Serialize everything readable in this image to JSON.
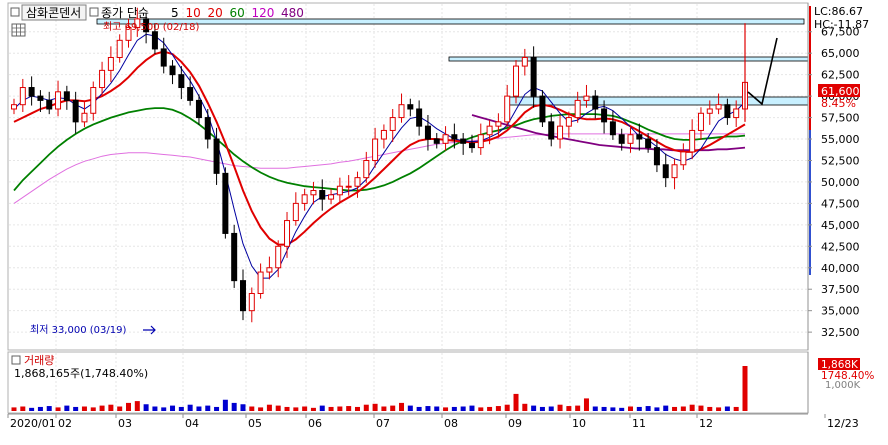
{
  "header": {
    "stock_name": "삼화콘덴서",
    "indicator_label": "종가 단순",
    "ma_periods": [
      "5",
      "10",
      "20",
      "60",
      "120",
      "480"
    ],
    "ma_colors": [
      "#000000",
      "#e00000",
      "#e00000",
      "#008000",
      "#c000c0",
      "#800080"
    ]
  },
  "top_right": {
    "lc": "LC:86.67",
    "hc": "HC:-11.87"
  },
  "annotations": {
    "high": "최고 69,500 (02/18)",
    "low": "최저 33,000 (03/19)"
  },
  "badges": {
    "price": "61,600",
    "pct": "8.45%",
    "volume": "1,868K",
    "volume_pct": "1748.40%"
  },
  "volume_panel": {
    "title": "거래량",
    "summary": "1,868,165주(1,748.40%)",
    "axis_label": "1,000K"
  },
  "chart_data": {
    "type": "candlestick",
    "y_ticks": [
      "67,500",
      "65,000",
      "62,500",
      "60,000",
      "57,500",
      "55,000",
      "52,500",
      "50,000",
      "47,500",
      "45,000",
      "42,500",
      "40,000",
      "37,500",
      "35,000",
      "32,500"
    ],
    "ylim": [
      31000,
      70500
    ],
    "x_labels": [
      "2020/01",
      "02",
      "03",
      "04",
      "05",
      "06",
      "07",
      "08",
      "09",
      "10",
      "11",
      "12",
      "12/23"
    ],
    "closes": [
      59000,
      61000,
      60000,
      59500,
      58500,
      60500,
      59500,
      57000,
      58000,
      61000,
      63000,
      64500,
      66500,
      68000,
      69000,
      67500,
      65500,
      63500,
      62500,
      61000,
      59500,
      57500,
      55000,
      51000,
      44000,
      38500,
      35000,
      37000,
      39500,
      40000,
      42500,
      45500,
      47500,
      48500,
      49000,
      48000,
      48500,
      49500,
      49500,
      50500,
      52500,
      55000,
      56000,
      57500,
      59000,
      58500,
      56500,
      55000,
      54500,
      55500,
      55000,
      54500,
      54000,
      55500,
      56500,
      57000,
      60000,
      63500,
      64500,
      60000,
      57000,
      55000,
      56500,
      57500,
      59500,
      60000,
      58500,
      57000,
      55500,
      54500,
      55500,
      55000,
      54000,
      52000,
      50500,
      52000,
      53500,
      56000,
      58000,
      58500,
      59000,
      57500,
      58500,
      61600
    ],
    "ma_short": [
      58500,
      59500,
      60000,
      59800,
      59500,
      59800,
      59700,
      59000,
      58500,
      59200,
      60300,
      61500,
      63000,
      64800,
      66500,
      67200,
      67000,
      66200,
      64800,
      63200,
      61800,
      60000,
      57900,
      54800,
      51000,
      46800,
      42800,
      40200,
      38800,
      38800,
      39800,
      42000,
      44200,
      46000,
      47600,
      48300,
      48500,
      48700,
      48900,
      49300,
      50300,
      51900,
      53400,
      54900,
      56300,
      57400,
      57600,
      57000,
      56200,
      55600,
      55000,
      54800,
      54700,
      54800,
      55200,
      55700,
      56600,
      58400,
      60200,
      61000,
      60600,
      59300,
      58000,
      57000,
      57200,
      58000,
      58600,
      58800,
      58300,
      57400,
      56400,
      55300,
      54900,
      54100,
      53200,
      52700,
      52400,
      52800,
      53900,
      55500,
      57100,
      57800,
      58300,
      59300
    ],
    "ma_20": [
      57000,
      57500,
      58000,
      58500,
      58800,
      59200,
      59500,
      59500,
      59400,
      59600,
      60000,
      60600,
      61300,
      62200,
      63300,
      64200,
      64900,
      65200,
      64900,
      64000,
      62800,
      61200,
      59200,
      57000,
      54500,
      51800,
      49000,
      46600,
      44700,
      43400,
      42700,
      42700,
      43300,
      44200,
      45200,
      46100,
      46900,
      47600,
      48200,
      48800,
      49600,
      50500,
      51500,
      52500,
      53500,
      54300,
      54800,
      55000,
      55000,
      54900,
      54800,
      54700,
      54600,
      54700,
      54900,
      55300,
      56000,
      57000,
      58100,
      58800,
      59000,
      58800,
      58400,
      57900,
      57500,
      57300,
      57300,
      57400,
      57300,
      57000,
      56500,
      55900,
      55300,
      54700,
      54100,
      53700,
      53500,
      53500,
      53800,
      54300,
      54900,
      55500,
      56100,
      56700
    ],
    "ma_60": [
      49000,
      50200,
      51200,
      52200,
      53200,
      54100,
      54900,
      55600,
      56200,
      56700,
      57100,
      57500,
      57800,
      58100,
      58300,
      58500,
      58600,
      58600,
      58400,
      58000,
      57400,
      56700,
      55900,
      55000,
      54100,
      53200,
      52400,
      51700,
      51100,
      50600,
      50200,
      49900,
      49700,
      49500,
      49400,
      49300,
      49200,
      49100,
      49000,
      49000,
      49100,
      49300,
      49600,
      50000,
      50500,
      51000,
      51600,
      52300,
      53000,
      53700,
      54300,
      54800,
      55200,
      55500,
      55800,
      56000,
      56300,
      56600,
      57000,
      57300,
      57500,
      57700,
      57800,
      57900,
      57900,
      57900,
      57900,
      57800,
      57700,
      57400,
      57000,
      56600,
      56100,
      55700,
      55300,
      55000,
      54900,
      54900,
      55000,
      55100,
      55200,
      55300,
      55300,
      55400
    ],
    "ma_120": [
      47500,
      48200,
      48900,
      49600,
      50300,
      50900,
      51500,
      52000,
      52400,
      52700,
      53000,
      53200,
      53300,
      53400,
      53400,
      53400,
      53300,
      53200,
      53100,
      53000,
      52900,
      52700,
      52500,
      52300,
      52100,
      51900,
      51800,
      51700,
      51600,
      51600,
      51600,
      51600,
      51700,
      51800,
      51900,
      52000,
      52100,
      52300,
      52400,
      52600,
      52800,
      53000,
      53200,
      53400,
      53600,
      53800,
      54000,
      54200,
      54400,
      54500,
      54600,
      54700,
      54800,
      54900,
      55000,
      55100,
      55200,
      55300,
      55400,
      55500,
      55500,
      55600,
      55600,
      55600,
      55600,
      55600,
      55600,
      55600,
      55600,
      55600,
      55600,
      55600,
      55600,
      55600,
      55600,
      55600,
      55600,
      55600,
      55600,
      55600,
      55600,
      55600,
      55600,
      55600
    ],
    "ma_480": [
      57800,
      57500,
      57200,
      56900,
      56600,
      56300,
      56000,
      55700,
      55500,
      55300,
      55100,
      54900,
      54700,
      54500,
      54300,
      54200,
      54100,
      54000,
      53900,
      53900,
      53800,
      53800,
      53700,
      53700,
      53700,
      53700,
      53700,
      53800,
      53800,
      53900,
      54000
    ],
    "volumes": [
      8,
      10,
      7,
      9,
      11,
      8,
      12,
      9,
      10,
      8,
      12,
      14,
      10,
      18,
      22,
      15,
      10,
      8,
      12,
      9,
      14,
      10,
      12,
      9,
      25,
      18,
      15,
      10,
      8,
      14,
      12,
      9,
      8,
      10,
      7,
      12,
      9,
      10,
      11,
      9,
      14,
      16,
      10,
      12,
      18,
      12,
      9,
      11,
      10,
      8,
      9,
      10,
      12,
      8,
      9,
      11,
      14,
      38,
      16,
      12,
      9,
      10,
      14,
      11,
      12,
      28,
      10,
      9,
      8,
      7,
      10,
      9,
      11,
      8,
      12,
      9,
      10,
      14,
      12,
      9,
      8,
      10,
      9,
      100
    ],
    "up_color": "#e00000",
    "down_color": "#0000d0"
  }
}
